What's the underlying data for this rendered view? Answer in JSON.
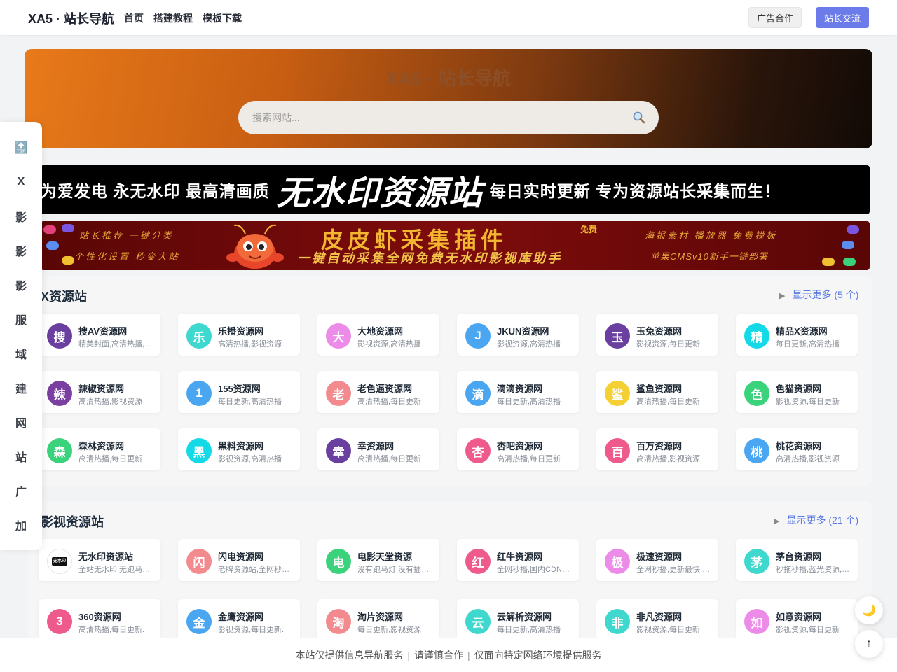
{
  "header": {
    "brand": "XA5 · 站长导航",
    "nav": [
      "首页",
      "搭建教程",
      "模板下载"
    ],
    "ad_button": "广告合作",
    "exchange_button": "站长交流"
  },
  "hero": {
    "title": "XA5 · 站长导航",
    "search_placeholder": "搜索网站..."
  },
  "banner1": {
    "left_text": "为爱发电  永无水印  最高清画质",
    "big_text": "无水印资源站",
    "right_text": "每日实时更新  专为资源站长采集而生！"
  },
  "banner2": {
    "title": "皮皮虾采集插件",
    "badge": "免费",
    "subtitle": "一键自动采集全网免费无水印影视库助手",
    "left_top": "站长推荐  一键分类",
    "left_bottom": "个性化设置  秒变大站",
    "right_top": "海报素材  播放器  免费模板",
    "right_bottom": "苹果CMSv10新手一键部署"
  },
  "sidebar": [
    "🔝",
    "X",
    "影",
    "影",
    "影",
    "服",
    "域",
    "建",
    "网",
    "站",
    "广",
    "加"
  ],
  "sections": [
    {
      "title": "X资源站",
      "more": "显示更多 (5 个)",
      "cards": [
        {
          "initial": "搜",
          "name": "搜AV资源网",
          "desc": "精美封面,高清热播,影视资源",
          "color": "#6a3fa0"
        },
        {
          "initial": "乐",
          "name": "乐播资源网",
          "desc": "高清热播,影视资源",
          "color": "#3ed8cf"
        },
        {
          "initial": "大",
          "name": "大地资源网",
          "desc": "影视资源,高清热播",
          "color": "#ec8be8"
        },
        {
          "initial": "J",
          "name": "JKUN资源网",
          "desc": "影视资源,高清热播",
          "color": "#4aa6f0"
        },
        {
          "initial": "玉",
          "name": "玉兔资源网",
          "desc": "影视资源,每日更新",
          "color": "#6a3fa0"
        },
        {
          "initial": "精",
          "name": "精品X资源网",
          "desc": "每日更新,高清热播",
          "color": "#14d9e6"
        },
        {
          "initial": "辣",
          "name": "辣椒资源网",
          "desc": "高清热播,影视资源",
          "color": "#7a3fa0"
        },
        {
          "initial": "1",
          "name": "155资源网",
          "desc": "每日更新,高清热播",
          "color": "#4aa6f0"
        },
        {
          "initial": "老",
          "name": "老色逼资源网",
          "desc": "高清热播,每日更新",
          "color": "#f28a8e"
        },
        {
          "initial": "滴",
          "name": "滴滴资源网",
          "desc": "每日更新,高清热播",
          "color": "#4aa6f0"
        },
        {
          "initial": "鲨",
          "name": "鲨鱼资源网",
          "desc": "高清热播,每日更新",
          "color": "#f5d032"
        },
        {
          "initial": "色",
          "name": "色猫资源网",
          "desc": "影视资源,每日更新",
          "color": "#3ad27a"
        },
        {
          "initial": "森",
          "name": "森林资源网",
          "desc": "高清热播,每日更新",
          "color": "#3ad27a"
        },
        {
          "initial": "黑",
          "name": "黑料资源网",
          "desc": "影视资源,高清热播",
          "color": "#14d9e6"
        },
        {
          "initial": "幸",
          "name": "幸资源网",
          "desc": "高清热播,每日更新",
          "color": "#6a3fa0"
        },
        {
          "initial": "杏",
          "name": "杏吧资源网",
          "desc": "高清热播,每日更新",
          "color": "#ee5a8c"
        },
        {
          "initial": "百",
          "name": "百万资源网",
          "desc": "高清热播,影视资源",
          "color": "#ee5a8c"
        },
        {
          "initial": "桃",
          "name": "桃花资源网",
          "desc": "高清热播,影视资源",
          "color": "#4aa6f0"
        }
      ]
    },
    {
      "title": "影视资源站",
      "more": "显示更多 (21 个)",
      "cards": [
        {
          "initial": "",
          "name": "无水印资源站",
          "desc": "全站无水印,无跑马灯,高清",
          "color": "#ffffff",
          "logo": "无水印"
        },
        {
          "initial": "闪",
          "name": "闪电资源网",
          "desc": "老牌资源站,全网秒播,更新快",
          "color": "#f28a8e"
        },
        {
          "initial": "电",
          "name": "电影天堂资源",
          "desc": "没有跑马灯,没有插播广告",
          "color": "#3ad27a"
        },
        {
          "initial": "红",
          "name": "红牛资源网",
          "desc": "全网秒播,国内CDN加速",
          "color": "#ee5a8c"
        },
        {
          "initial": "极",
          "name": "极速资源网",
          "desc": "全网秒播,更新最快,稳定",
          "color": "#ec8be8"
        },
        {
          "initial": "茅",
          "name": "茅台资源网",
          "desc": "秒拖秒播,蓝光资源,高清",
          "color": "#3ed8cf"
        },
        {
          "initial": "3",
          "name": "360资源网",
          "desc": "高清热播,每日更新.",
          "color": "#ee5a8c"
        },
        {
          "initial": "金",
          "name": "金鹰资源网",
          "desc": "影视资源,每日更新.",
          "color": "#4aa6f0"
        },
        {
          "initial": "淘",
          "name": "淘片资源网",
          "desc": "每日更新,影视资源",
          "color": "#f28a8e"
        },
        {
          "initial": "云",
          "name": "云解析资源网",
          "desc": "每日更新,高清热播",
          "color": "#3ed8cf"
        },
        {
          "initial": "非",
          "name": "非凡资源网",
          "desc": "影视资源,每日更新",
          "color": "#3ed8cf"
        },
        {
          "initial": "如",
          "name": "如意资源网",
          "desc": "影视资源,每日更新",
          "color": "#ec8be8"
        }
      ]
    }
  ],
  "footer": [
    "本站仅提供信息导航服务",
    "请谨慎合作",
    "仅面向特定网络环境提供服务"
  ],
  "float": {
    "theme": "🌙",
    "top": "↑"
  }
}
